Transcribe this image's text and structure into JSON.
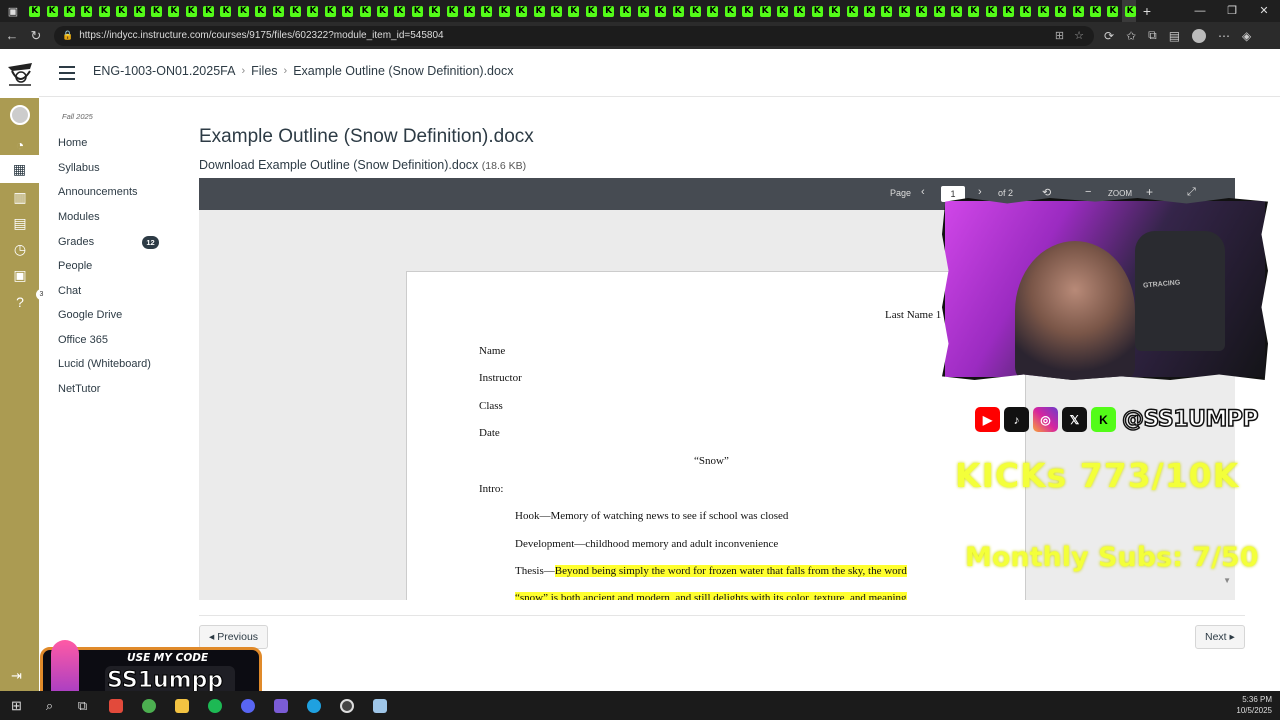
{
  "browser": {
    "tab_glyph": "K",
    "tab_count": 64,
    "close_glyph": "✕",
    "newtab_glyph": "+",
    "url": "https://indycc.instructure.com/courses/9175/files/602322?module_item_id=545804"
  },
  "header": {
    "breadcrumbs": [
      "ENG-1003-ON01.2025FA",
      "Files",
      "Example Outline (Snow Definition).docx"
    ],
    "separator": "›"
  },
  "course_nav": {
    "term": "Fall 2025",
    "items": [
      {
        "label": "Home"
      },
      {
        "label": "Syllabus"
      },
      {
        "label": "Announcements"
      },
      {
        "label": "Modules"
      },
      {
        "label": "Grades",
        "badge": "12"
      },
      {
        "label": "People"
      },
      {
        "label": "Chat"
      },
      {
        "label": "Google Drive"
      },
      {
        "label": "Office 365"
      },
      {
        "label": "Lucid (Whiteboard)"
      },
      {
        "label": "NetTutor"
      }
    ]
  },
  "global_nav": {
    "help_badge": "3"
  },
  "page": {
    "title": "Example Outline (Snow Definition).docx",
    "download_label": "Download Example Outline (Snow Definition).docx",
    "file_size": "(18.6 KB)"
  },
  "viewer": {
    "page_label": "Page",
    "current_page": "1",
    "of_pages": "of 2",
    "zoom_label": "ZOOM"
  },
  "document": {
    "header_right": "Last Name 1",
    "lines": [
      "Name",
      "Instructor",
      "Class",
      "Date"
    ],
    "title": "“Snow”",
    "intro_label": "Intro:",
    "hook": "Hook—Memory of watching news to see if school was closed",
    "development": "Development—childhood memory and adult inconvenience",
    "thesis_label": "Thesis—",
    "thesis_text": "Beyond being simply the word for frozen water that falls from the sky, the word",
    "thesis_text2": "“snow” is both ancient and modern, and still delights with its color, texture, and meaning"
  },
  "footer": {
    "previous_label": "◂ Previous",
    "next_label": "Next ▸"
  },
  "overlay": {
    "webcam_chair_text": "GTRACING",
    "handle": "@SS1UMPP",
    "kicks": "KICKs 773/10K",
    "subs": "Monthly Subs: 7/50",
    "promo_label": "USE MY CODE",
    "promo_code": "SS1umpp"
  },
  "taskbar": {
    "time": "5:36 PM",
    "date": "10/5/2025"
  },
  "colors": {
    "canvas_nav": "#ab9b52",
    "kick_green": "#53fc18",
    "highlight": "#ffff2e",
    "overlay_yellow": "#f3ff3a"
  }
}
